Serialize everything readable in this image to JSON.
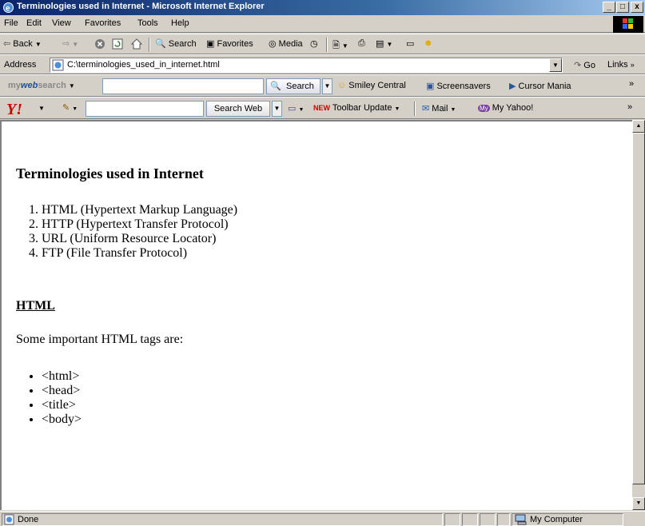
{
  "window": {
    "title": "Terminologies used in Internet - Microsoft Internet Explorer",
    "minimize": "_",
    "maximize": "□",
    "close": "x"
  },
  "menu": [
    "File",
    "Edit",
    "View",
    "Favorites",
    "Tools",
    "Help"
  ],
  "toolbar": {
    "back": "Back",
    "search": "Search",
    "favorites": "Favorites",
    "media": "Media"
  },
  "address": {
    "label": "Address",
    "value": "C:\\terminologies_used_in_internet.html",
    "go": "Go",
    "links": "Links"
  },
  "mywebsearch": {
    "logo_prefix": "my",
    "logo_strong": "web",
    "logo_suffix": "search",
    "search_button": "Search",
    "smiley": "Smiley Central",
    "screensavers": "Screensavers",
    "cursor": "Cursor Mania"
  },
  "yahoo": {
    "logo": "Y!",
    "search_button": "Search Web",
    "new_badge": "NEW",
    "toolbar_update": "Toolbar Update",
    "mail": "Mail",
    "my_badge": "My",
    "my_yahoo": "My Yahoo!"
  },
  "page": {
    "heading": "Terminologies used in Internet",
    "terms": [
      "HTML (Hypertext Markup Language)",
      "HTTP (Hypertext Transfer Protocol)",
      "URL (Uniform Resource Locator)",
      "FTP (File Transfer Protocol)"
    ],
    "section_title": "HTML",
    "intro": "Some important HTML tags are:",
    "tags": [
      "<html>",
      "<head>",
      "<title>",
      "<body>"
    ]
  },
  "status": {
    "text": "Done",
    "zone": "My Computer"
  },
  "colors": {
    "titlebar_start": "#0a246a",
    "titlebar_end": "#a6caf0",
    "chrome": "#d4d0c8",
    "yahoo_red": "#cc0000"
  }
}
